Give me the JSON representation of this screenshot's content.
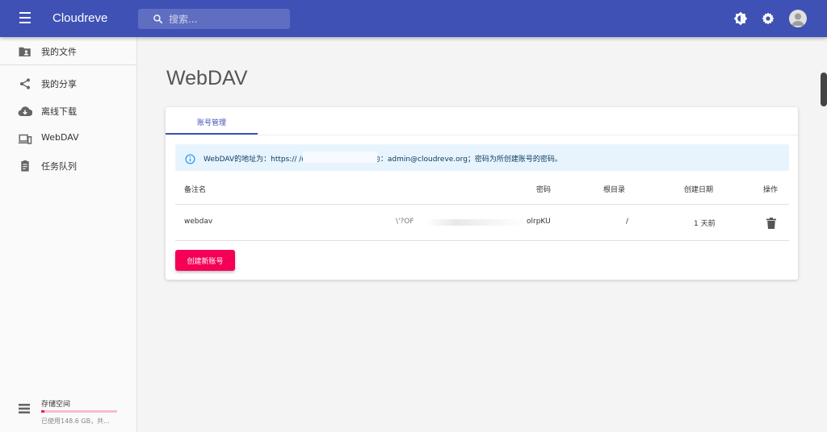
{
  "app": {
    "name": "Cloudreve"
  },
  "search": {
    "placeholder": "搜索..."
  },
  "sidebar": {
    "items": [
      {
        "label": "我的文件",
        "icon": "folder-account-icon"
      },
      {
        "label": "我的分享",
        "icon": "share-icon"
      },
      {
        "label": "离线下载",
        "icon": "cloud-download-icon"
      },
      {
        "label": "WebDAV",
        "icon": "devices-icon"
      },
      {
        "label": "任务队列",
        "icon": "clipboard-list-icon"
      }
    ],
    "storage": {
      "title": "存储空间",
      "info": "已使用148.6 GB，共...",
      "used_fraction": 0.04
    }
  },
  "page": {
    "title": "WebDAV"
  },
  "tabs": [
    {
      "label": "账号管理",
      "active": true
    }
  ],
  "alert": {
    "text": "WebDAV的地址为：https://                                  /dav；登陆用户名统一为：admin@cloudreve.org；密码为所创建账号的密码。"
  },
  "table": {
    "headers": {
      "name": "备注名",
      "password": "密码",
      "root": "根目录",
      "created": "创建日期",
      "actions": "操作"
    },
    "rows": [
      {
        "name": "webdav",
        "password_start": "\\'?OF",
        "password_end": "olrpKU",
        "root": "/",
        "created": "1 天前"
      }
    ]
  },
  "buttons": {
    "create": "创建新账号"
  },
  "colors": {
    "primary": "#3f51b5",
    "accent": "#f50057",
    "alert_bg": "#e8f4fd"
  }
}
